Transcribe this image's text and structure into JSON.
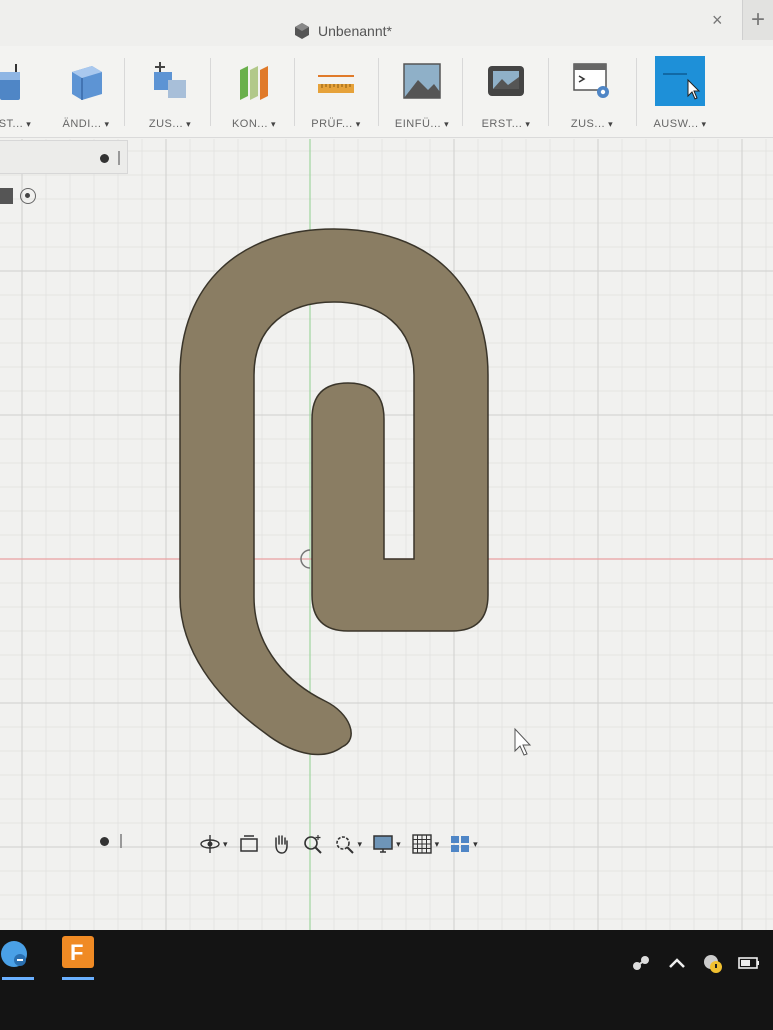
{
  "window": {
    "title": "Unbenannt*",
    "close_glyph": "×",
    "new_tab_glyph": "+"
  },
  "toolbar": {
    "tools": [
      {
        "label": "ST...",
        "icon": "sketch-extrude-icon"
      },
      {
        "label": "ÄNDI...",
        "icon": "modify-box-icon"
      },
      {
        "label": "ZUS...",
        "icon": "assemble-icon"
      },
      {
        "label": "KON...",
        "icon": "construct-planes-icon"
      },
      {
        "label": "PRÜF...",
        "icon": "inspect-ruler-icon"
      },
      {
        "label": "EINFÜ...",
        "icon": "insert-image-icon"
      },
      {
        "label": "ERST...",
        "icon": "create-image-icon"
      },
      {
        "label": "ZUS...",
        "icon": "addins-gear-icon"
      },
      {
        "label": "AUSW...",
        "icon": "select-cursor-icon"
      }
    ]
  },
  "colors": {
    "shape_fill": "#8a7d63",
    "shape_stroke": "#3a352a",
    "grid_minor": "#e0e0de",
    "grid_major": "#cfcfcd",
    "axis_green": "#9fd69f",
    "axis_red": "#e9a0a0",
    "accent": "#1e90d8"
  },
  "navbar": {
    "buttons": [
      {
        "icon": "orbit-icon",
        "caret": true
      },
      {
        "icon": "look-at-icon",
        "caret": false
      },
      {
        "icon": "pan-hand-icon",
        "caret": false
      },
      {
        "icon": "zoom-icon",
        "caret": false
      },
      {
        "icon": "zoom-window-icon",
        "caret": true
      },
      {
        "icon": "display-settings-icon",
        "caret": true
      },
      {
        "icon": "grid-settings-icon",
        "caret": true
      },
      {
        "icon": "viewports-icon",
        "caret": true
      }
    ]
  },
  "taskbar": {
    "apps": [
      {
        "icon": "app-blue-icon"
      },
      {
        "icon": "fusion-app-icon",
        "letter": "F"
      }
    ],
    "tray": [
      "network-icon",
      "chevron-up-icon",
      "shield-status-icon",
      "battery-icon"
    ]
  }
}
